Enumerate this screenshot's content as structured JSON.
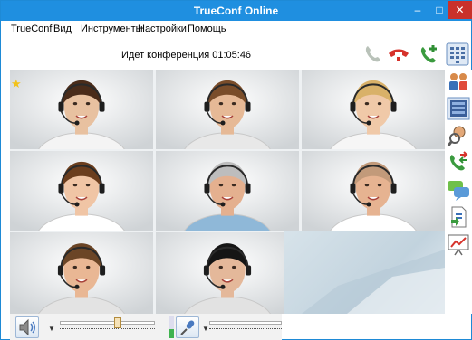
{
  "window": {
    "title": "TrueConf Online",
    "minimize_glyph": "–",
    "maximize_glyph": "□",
    "close_glyph": "✕"
  },
  "menu": {
    "items": [
      {
        "label": "TrueConf"
      },
      {
        "label": "Вид"
      },
      {
        "label": "Инструменты"
      },
      {
        "label": "Настройки"
      },
      {
        "label": "Помощь"
      }
    ]
  },
  "conference": {
    "status": "Идет конференция 01:05:46"
  },
  "toolbar": {
    "icons": [
      "phone-icon",
      "hang-up-icon",
      "add-call-icon",
      "dialpad-icon"
    ]
  },
  "sidebar": {
    "icons": [
      "contacts-icon",
      "video-layout-icon",
      "search-user-icon",
      "call-transfer-icon",
      "chat-icon",
      "file-transfer-icon",
      "whiteboard-icon"
    ]
  },
  "participants": {
    "tiles": [
      {
        "name": "participant-1",
        "favorite": true,
        "skin": "#e8c1a0",
        "hair": "#4a2c1a",
        "shirt": "#f4f4f4"
      },
      {
        "name": "participant-2",
        "favorite": false,
        "skin": "#e6b996",
        "hair": "#7a4d2a",
        "shirt": "#e8e8e8"
      },
      {
        "name": "participant-3",
        "favorite": false,
        "skin": "#f0c9a8",
        "hair": "#d9b169",
        "shirt": "#f6f6f6"
      },
      {
        "name": "participant-4",
        "favorite": false,
        "skin": "#f0c5a5",
        "hair": "#6b3e1e",
        "shirt": "#ffffff"
      },
      {
        "name": "participant-5",
        "favorite": false,
        "skin": "#e4b08f",
        "hair": "#bdbdbd",
        "shirt": "#8fb8d8"
      },
      {
        "name": "participant-6",
        "favorite": false,
        "skin": "#e6b391",
        "hair": "#c29a7a",
        "shirt": "#ffffff"
      },
      {
        "name": "participant-7",
        "favorite": false,
        "skin": "#e9b794",
        "hair": "#6b4526",
        "shirt": "#e3e3e3"
      },
      {
        "name": "participant-8",
        "favorite": false,
        "skin": "#e4b89a",
        "hair": "#151515",
        "shirt": "#e2e2e2"
      }
    ]
  },
  "audio": {
    "speaker_volume": 0.62,
    "mic_volume": 0.0,
    "mic_level": 0.4
  },
  "colors": {
    "titlebar": "#1f8fe0",
    "close": "#c9312b",
    "favorite": "#f2c21b"
  }
}
